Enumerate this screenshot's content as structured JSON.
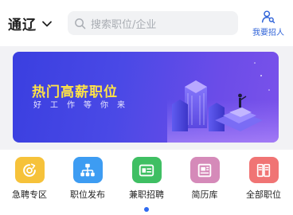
{
  "header": {
    "city": "通辽",
    "search_placeholder": "搜索职位/企业",
    "recruit_label": "我要招人"
  },
  "banner": {
    "title": "热门高薪职位",
    "subtitle": "好工作等你来"
  },
  "quick_nav": [
    {
      "label": "急聘专区",
      "icon": "urgent-hire-icon",
      "color": "#f6c23a"
    },
    {
      "label": "职位发布",
      "icon": "org-chart-icon",
      "color": "#3d9cf2"
    },
    {
      "label": "兼职招聘",
      "icon": "id-card-icon",
      "color": "#3fbf63"
    },
    {
      "label": "简历库",
      "icon": "resume-library-icon",
      "color": "#d58ab9"
    },
    {
      "label": "全部职位",
      "icon": "all-jobs-icon",
      "color": "#f07474"
    }
  ],
  "colors": {
    "accent": "#2f63d8",
    "banner_title": "#ffe347",
    "pager_active": "#2f6bf0"
  }
}
